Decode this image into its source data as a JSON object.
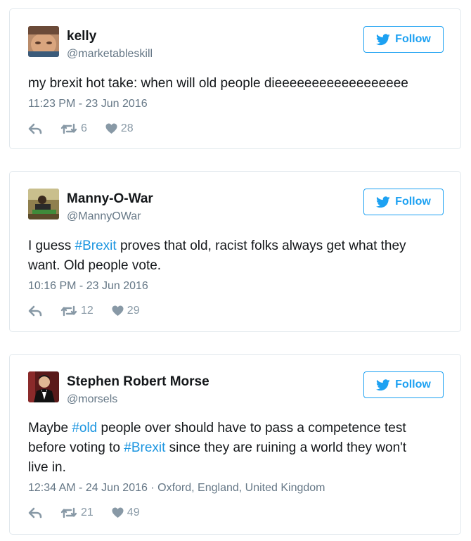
{
  "follow_label": "Follow",
  "colors": {
    "accent": "#1da1f2",
    "hashtag": "#1b95e0",
    "muted": "#657786",
    "action": "#8899a6"
  },
  "tweets": [
    {
      "name": "kelly",
      "handle": "@marketableskill",
      "text": "my brexit hot take: when will old people dieeeeeeeeeeeeeeeeee",
      "timestamp": "11:23 PM - 23 Jun 2016",
      "location": "",
      "retweets": "6",
      "likes": "28"
    },
    {
      "name": "Manny-O-War",
      "handle": "@MannyOWar",
      "text_parts": [
        "I guess ",
        "#Brexit",
        " proves that old, racist folks always get what they want. Old people vote."
      ],
      "timestamp": "10:16 PM - 23 Jun 2016",
      "location": "",
      "retweets": "12",
      "likes": "29"
    },
    {
      "name": "Stephen Robert Morse",
      "handle": "@morsels",
      "text_parts": [
        "Maybe ",
        "#old",
        " people over should have to pass a competence test before voting to ",
        "#Brexit",
        " since they are ruining a world they won't live in."
      ],
      "timestamp": "12:34 AM - 24 Jun 2016",
      "location": "Oxford, England, United Kingdom",
      "retweets": "21",
      "likes": "49"
    }
  ],
  "icons": {
    "bird": "twitter-bird-icon",
    "reply": "reply-icon",
    "retweet": "retweet-icon",
    "like": "heart-icon"
  }
}
